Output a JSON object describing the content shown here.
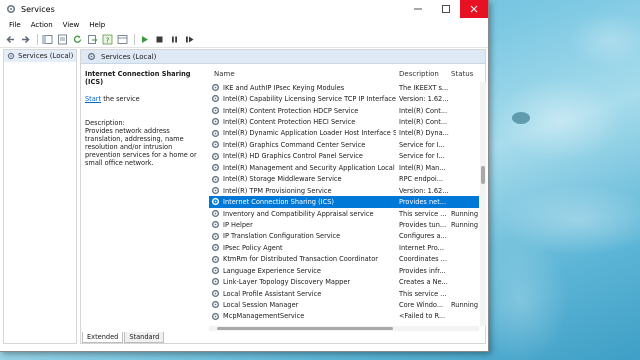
{
  "window": {
    "title": "Services"
  },
  "menu": [
    "File",
    "Action",
    "View",
    "Help"
  ],
  "toolbar_icons": [
    "back-icon",
    "forward-icon",
    "console-tree-icon",
    "properties-icon",
    "refresh-icon",
    "export-icon",
    "help-icon",
    "view-icon",
    "start-icon",
    "stop-icon",
    "pause-icon",
    "restart-icon"
  ],
  "nav": {
    "item": "Services (Local)"
  },
  "content": {
    "header": "Services (Local)",
    "detail": {
      "title": "Internet Connection Sharing (ICS)",
      "start_link": "Start",
      "start_suffix": " the service",
      "description_label": "Description:",
      "description": "Provides network address translation, addressing, name resolution and/or intrusion prevention services for a home or small office network."
    },
    "columns": {
      "name": "Name",
      "description": "Description",
      "status": "Status"
    },
    "rows": [
      {
        "name": "IKE and AuthIP IPsec Keying Modules",
        "desc": "The IKEEXT s...",
        "status": ""
      },
      {
        "name": "Intel(R) Capability Licensing Service TCP IP Interface",
        "desc": "Version: 1.62...",
        "status": ""
      },
      {
        "name": "Intel(R) Content Protection HDCP Service",
        "desc": "Intel(R) Cont...",
        "status": ""
      },
      {
        "name": "Intel(R) Content Protection HECI Service",
        "desc": "Intel(R) Cont...",
        "status": ""
      },
      {
        "name": "Intel(R) Dynamic Application Loader Host Interface Se...",
        "desc": "Intel(R) Dyna...",
        "status": ""
      },
      {
        "name": "Intel(R) Graphics Command Center Service",
        "desc": "Service for I...",
        "status": ""
      },
      {
        "name": "Intel(R) HD Graphics Control Panel Service",
        "desc": "Service for I...",
        "status": ""
      },
      {
        "name": "Intel(R) Management and Security Application Local ...",
        "desc": "Intel(R) Man...",
        "status": ""
      },
      {
        "name": "Intel(R) Storage Middleware Service",
        "desc": "RPC endpoi...",
        "status": ""
      },
      {
        "name": "Intel(R) TPM Provisioning Service",
        "desc": "Version: 1.62...",
        "status": ""
      },
      {
        "name": "Internet Connection Sharing (ICS)",
        "desc": "Provides net...",
        "status": "",
        "selected": true
      },
      {
        "name": "Inventory and Compatibility Appraisal service",
        "desc": "This service ...",
        "status": "Running"
      },
      {
        "name": "IP Helper",
        "desc": "Provides tun...",
        "status": "Running"
      },
      {
        "name": "IP Translation Configuration Service",
        "desc": "Configures a...",
        "status": ""
      },
      {
        "name": "IPsec Policy Agent",
        "desc": "Internet Pro...",
        "status": ""
      },
      {
        "name": "KtmRm for Distributed Transaction Coordinator",
        "desc": "Coordinates ...",
        "status": ""
      },
      {
        "name": "Language Experience Service",
        "desc": "Provides infr...",
        "status": ""
      },
      {
        "name": "Link-Layer Topology Discovery Mapper",
        "desc": "Creates a Ne...",
        "status": ""
      },
      {
        "name": "Local Profile Assistant Service",
        "desc": "This service ...",
        "status": ""
      },
      {
        "name": "Local Session Manager",
        "desc": "Core Windo...",
        "status": "Running"
      },
      {
        "name": "McpManagementService",
        "desc": "<Failed to R...",
        "status": ""
      }
    ]
  },
  "tabs": [
    "Extended",
    "Standard"
  ],
  "colors": {
    "selection": "#0078d7",
    "close_button": "#e81123",
    "link": "#0066cc"
  }
}
